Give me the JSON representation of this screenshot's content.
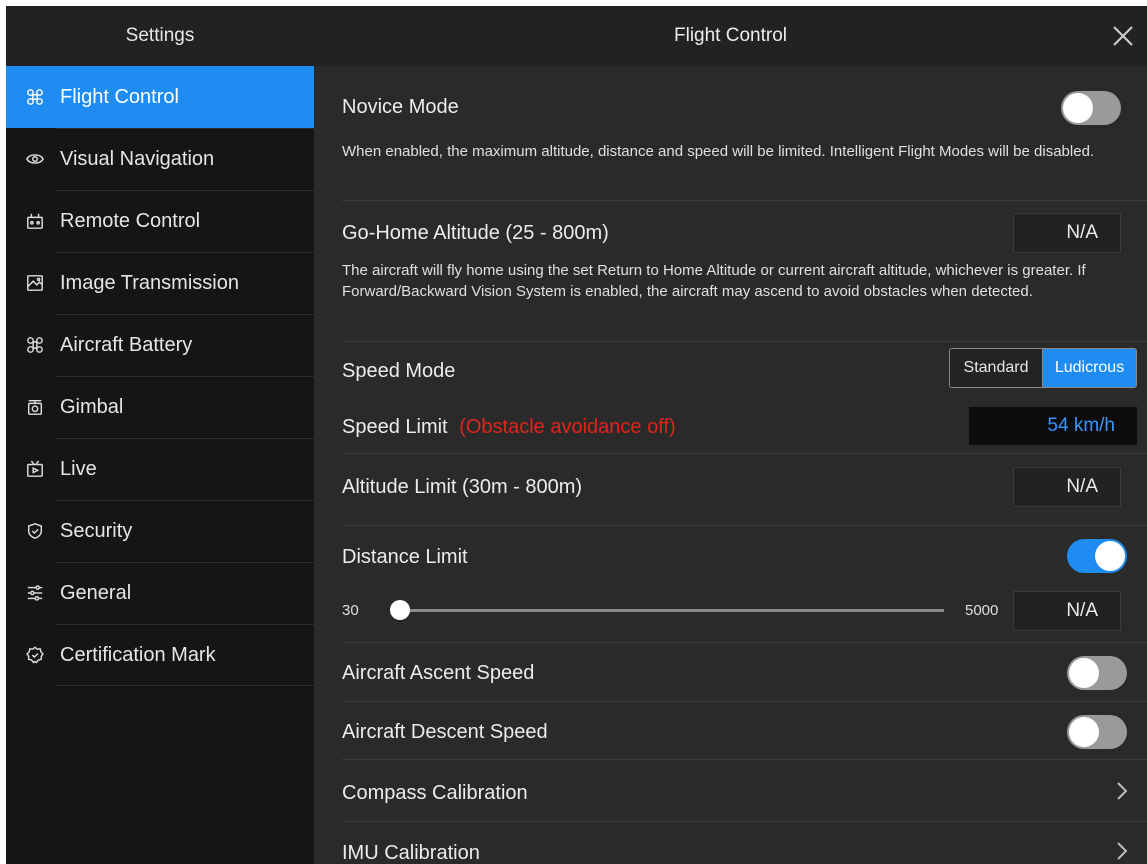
{
  "sidebar": {
    "title": "Settings",
    "items": [
      {
        "label": "Flight Control",
        "icon": "drone-icon",
        "active": true
      },
      {
        "label": "Visual Navigation",
        "icon": "eye-icon"
      },
      {
        "label": "Remote Control",
        "icon": "remote-icon"
      },
      {
        "label": "Image Transmission",
        "icon": "image-icon"
      },
      {
        "label": "Aircraft Battery",
        "icon": "battery-drone-icon"
      },
      {
        "label": "Gimbal",
        "icon": "camera-icon"
      },
      {
        "label": "Live",
        "icon": "live-tv-icon"
      },
      {
        "label": "Security",
        "icon": "shield-icon"
      },
      {
        "label": "General",
        "icon": "sliders-icon"
      },
      {
        "label": "Certification Mark",
        "icon": "badge-icon"
      }
    ]
  },
  "main": {
    "title": "Flight Control",
    "novice": {
      "title": "Novice Mode",
      "desc": "When enabled, the maximum altitude, distance and speed will be limited. Intelligent Flight Modes will be disabled.",
      "enabled": false
    },
    "go_home": {
      "title": "Go-Home Altitude (25 - 800m)",
      "value": "N/A",
      "desc": "The aircraft will fly home using the set Return to Home Altitude or current aircraft altitude, whichever is greater. If Forward/Backward Vision System is enabled, the aircraft may ascend to avoid obstacles when detected."
    },
    "speed_mode": {
      "title": "Speed Mode",
      "options": [
        "Standard",
        "Ludicrous"
      ],
      "selected": "Ludicrous"
    },
    "speed_limit": {
      "title": "Speed Limit",
      "warning": "(Obstacle avoidance off)",
      "value": "54 km/h"
    },
    "altitude_limit": {
      "title": "Altitude Limit (30m - 800m)",
      "value": "N/A"
    },
    "distance_limit": {
      "title": "Distance Limit",
      "enabled": true,
      "min_label": "30",
      "max_label": "5000",
      "value": "N/A"
    },
    "ascent_speed": {
      "title": "Aircraft Ascent Speed",
      "enabled": false
    },
    "descent_speed": {
      "title": "Aircraft Descent Speed",
      "enabled": false
    },
    "compass": {
      "title": "Compass Calibration"
    },
    "imu": {
      "title": "IMU Calibration"
    }
  },
  "colors": {
    "accent": "#1e8cf0",
    "warning": "#e0241b",
    "speed_value": "#3a95ff"
  }
}
